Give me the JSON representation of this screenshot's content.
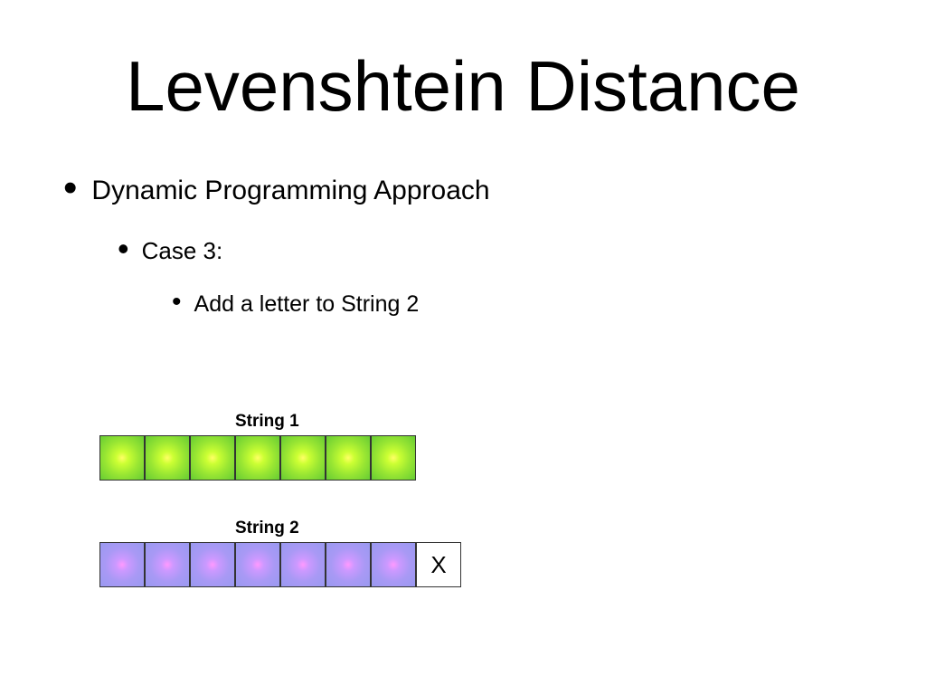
{
  "title": "Levenshtein Distance",
  "bullets": {
    "level1": "Dynamic Programming Approach",
    "level2": "Case 3:",
    "level3": "Add a letter to String 2"
  },
  "diagram": {
    "string1_label": "String 1",
    "string2_label": "String 2",
    "string1_cells": 7,
    "string2_cells": 7,
    "added_letter": "X",
    "colors": {
      "string1": "green-gradient",
      "string2": "purple-gradient",
      "added": "white"
    }
  }
}
